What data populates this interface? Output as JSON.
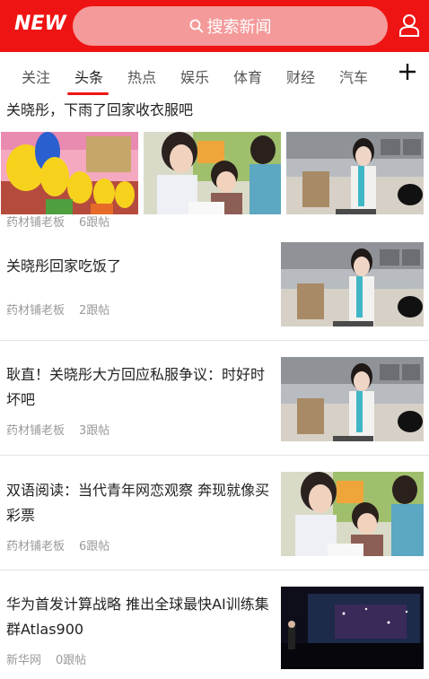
{
  "header": {
    "logo": "NEW",
    "search_placeholder": "搜索新闻"
  },
  "tabs": [
    {
      "label": "关注",
      "active": false
    },
    {
      "label": "头条",
      "active": true
    },
    {
      "label": "热点",
      "active": false
    },
    {
      "label": "娱乐",
      "active": false
    },
    {
      "label": "体育",
      "active": false
    },
    {
      "label": "财经",
      "active": false
    },
    {
      "label": "汽车",
      "active": false
    }
  ],
  "feed": [
    {
      "title": "关晓彤，下雨了回家收衣服吧",
      "source": "药材铺老板",
      "replies": "6跟帖",
      "layout": "three-images"
    },
    {
      "title": "关晓彤回家吃饭了",
      "source": "药材铺老板",
      "replies": "2跟帖",
      "layout": "single-image"
    },
    {
      "title": "耿直！关晓彤大方回应私服争议：时好时坏吧",
      "source": "药材铺老板",
      "replies": "3跟帖",
      "layout": "single-image"
    },
    {
      "title": "双语阅读：当代青年网恋观察 奔现就像买彩票",
      "source": "药材铺老板",
      "replies": "6跟帖",
      "layout": "single-image"
    },
    {
      "title": "华为首发计算战略 推出全球最快AI训练集群Atlas900",
      "source": "新华网",
      "replies": "0跟帖",
      "layout": "single-image"
    }
  ],
  "colors": {
    "brand": "#ef1414",
    "search_bg": "#f49a9a",
    "meta": "#9a9a9a"
  }
}
